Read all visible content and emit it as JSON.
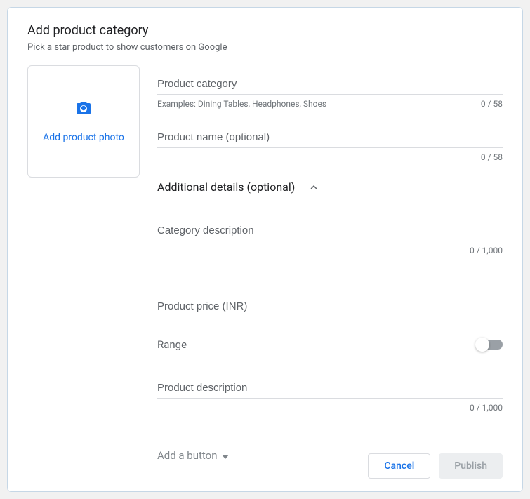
{
  "header": {
    "title": "Add product category",
    "subtitle": "Pick a star product to show customers on Google"
  },
  "photo": {
    "label": "Add product photo"
  },
  "fields": {
    "category": {
      "placeholder": "Product category",
      "example": "Examples: Dining Tables, Headphones, Shoes",
      "counter": "0 / 58"
    },
    "product_name": {
      "placeholder": "Product name (optional)",
      "counter": "0 / 58"
    },
    "category_desc": {
      "placeholder": "Category description",
      "counter": "0 / 1,000"
    },
    "price": {
      "placeholder": "Product price (INR)"
    },
    "product_desc": {
      "placeholder": "Product description",
      "counter": "0 / 1,000"
    }
  },
  "section": {
    "additional_label": "Additional details (optional)"
  },
  "range": {
    "label": "Range"
  },
  "add_button": {
    "label": "Add a button"
  },
  "footer": {
    "cancel": "Cancel",
    "publish": "Publish"
  }
}
